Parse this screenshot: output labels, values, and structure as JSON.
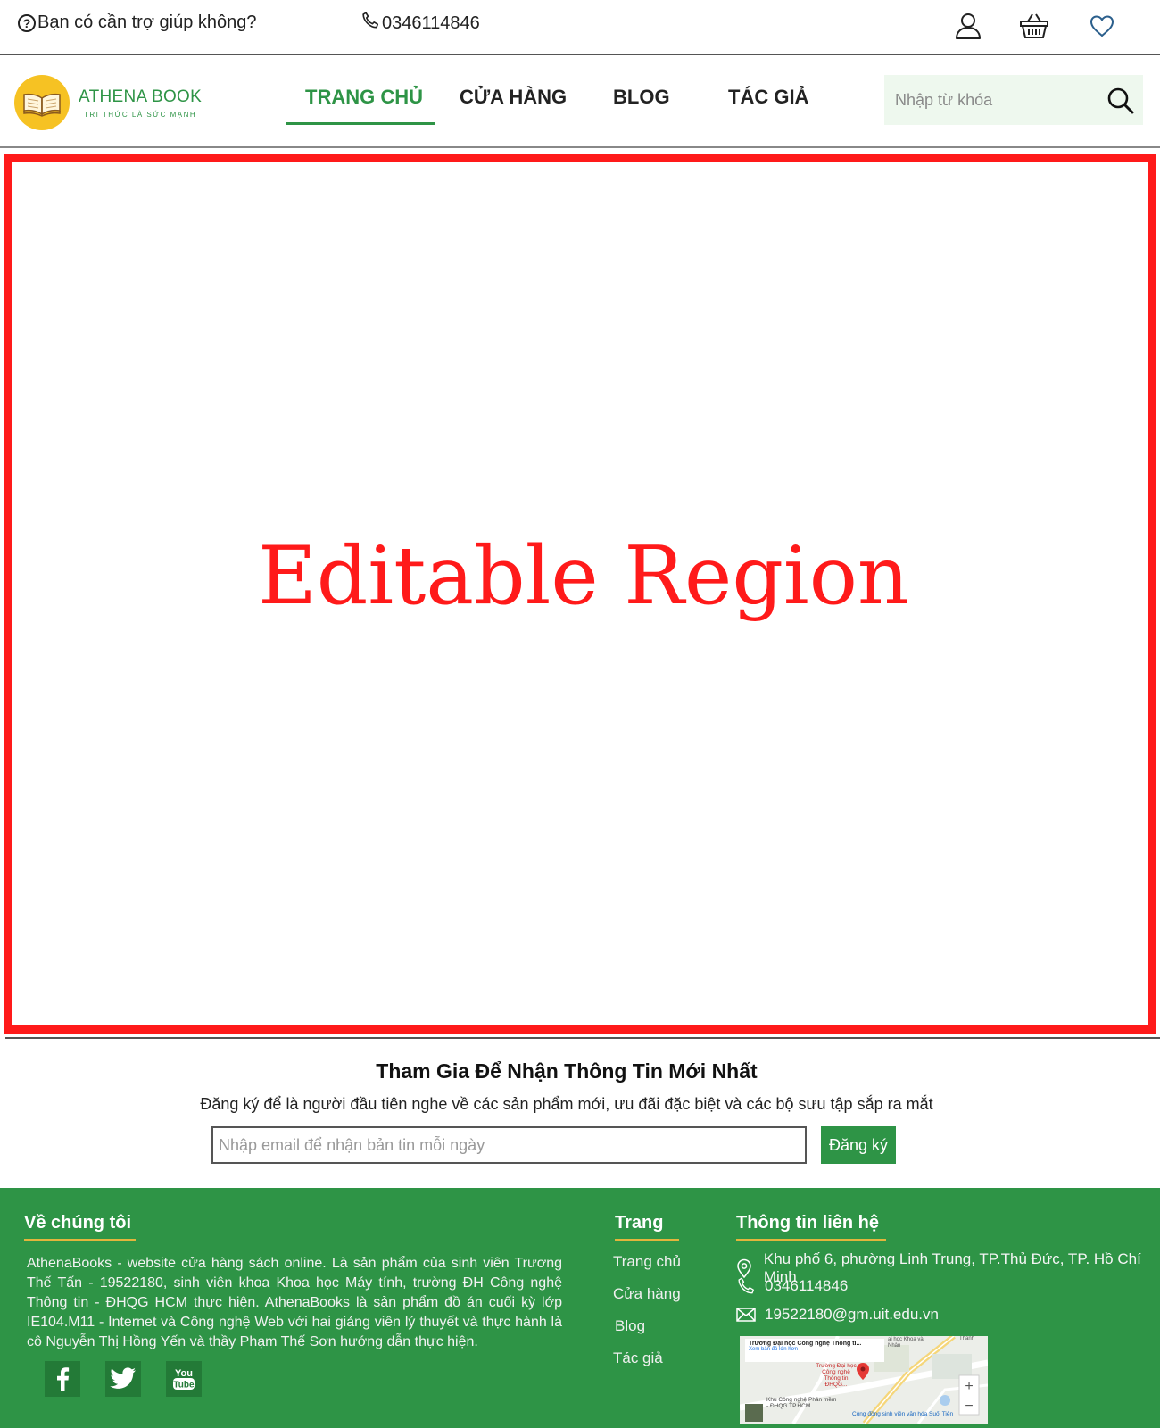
{
  "topbar": {
    "help_text": "Bạn có cần trợ giúp không?",
    "phone": "0346114846",
    "icons": [
      "user-icon",
      "basket-icon",
      "heart-icon"
    ]
  },
  "header": {
    "logo_title": "ATHENA BOOK",
    "logo_subtitle": "TRI THỨC LÀ SỨC MẠNH",
    "nav": [
      "TRANG CHỦ",
      "CỬA HÀNG",
      "BLOG",
      "TÁC GIẢ"
    ],
    "active_nav": "TRANG CHỦ",
    "search_placeholder": "Nhập từ khóa"
  },
  "editable": {
    "label": "Editable Region"
  },
  "newsletter": {
    "title": "Tham Gia Để Nhận Thông Tin Mới Nhất",
    "description": "Đăng ký để là người đầu tiên nghe về các sản phẩm mới, ưu đãi đặc biệt và các bộ sưu tập sắp ra mắt",
    "input_placeholder": "Nhập email để nhận bản tin mỗi ngày",
    "button": "Đăng ký"
  },
  "footer": {
    "about": {
      "heading": "Về chúng tôi",
      "text": "AthenaBooks - website cửa hàng sách online. Là sản phẩm của sinh viên Trương Thế Tấn - 19522180, sinh viên khoa Khoa học Máy tính, trường ĐH Công nghệ Thông tin - ĐHQG HCM thực hiện. AthenaBooks là sản phẩm đồ án cuối kỳ lớp IE104.M11 - Internet và Công nghệ Web với hai giảng viên lý thuyết và thực hành là cô Nguyễn Thị Hồng Yến và thầy Phạm Thế Sơn hướng dẫn thực hiện.",
      "social": [
        "facebook-icon",
        "twitter-icon",
        "youtube-icon"
      ],
      "youtube_label_1": "You",
      "youtube_label_2": "Tube"
    },
    "pages": {
      "heading": "Trang",
      "links": [
        "Trang chủ",
        "Cửa hàng",
        "Blog",
        "Tác giả"
      ]
    },
    "contact": {
      "heading": "Thông tin liên hệ",
      "address": "Khu phố 6, phường Linh Trung, TP.Thủ Đức, TP. Hồ Chí Minh",
      "phone": "0346114846",
      "email": "19522180@gm.uit.edu.vn",
      "map_title": "Trường Đại học Công nghệ Thông ti...",
      "map_link": "Xem bản đồ lớn hơn",
      "map_place_1": "Trường Đại học Công nghệ Thông tin ĐHQG...",
      "map_place_2": "Khu Công nghệ Phần mềm - ĐHQG TP.HCM",
      "map_place_3": "Cộng đồng sinh viên văn hóa Suối Tiên",
      "map_place_4": "ại học Khoa và Nhân",
      "map_place_5": "Thanh"
    }
  },
  "colors": {
    "brand_green": "#2e9446",
    "accent_gold": "#e3b53c",
    "editable_red": "#ff1a1a",
    "logo_yellow": "#f6c223"
  }
}
